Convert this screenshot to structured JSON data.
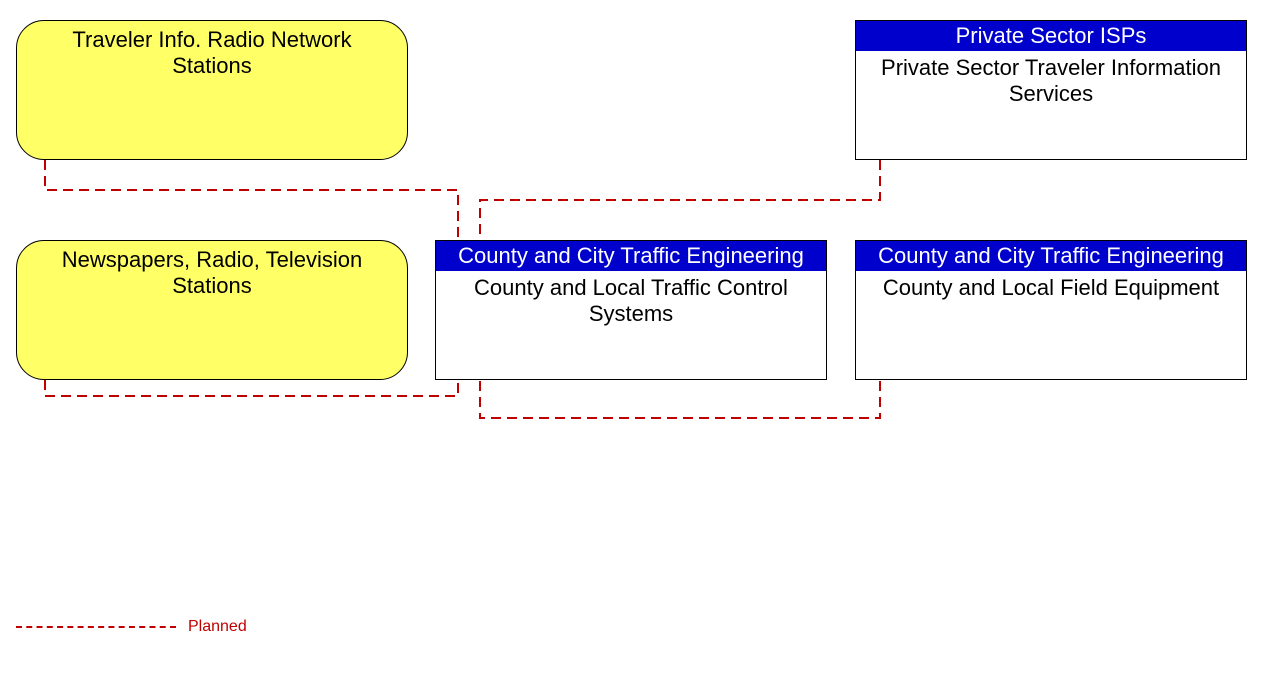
{
  "nodes": {
    "traveler_radio": {
      "body": "Traveler Info. Radio Network Stations"
    },
    "newspapers": {
      "body": "Newspapers, Radio, Television Stations"
    },
    "private_isps": {
      "header": "Private Sector ISPs",
      "body": "Private Sector Traveler Information Services"
    },
    "traffic_control": {
      "header": "County and City Traffic Engineering",
      "body": "County and Local Traffic Control Systems"
    },
    "field_equipment": {
      "header": "County and City Traffic Engineering",
      "body": "County and Local Field Equipment"
    }
  },
  "legend": {
    "planned": "Planned"
  }
}
